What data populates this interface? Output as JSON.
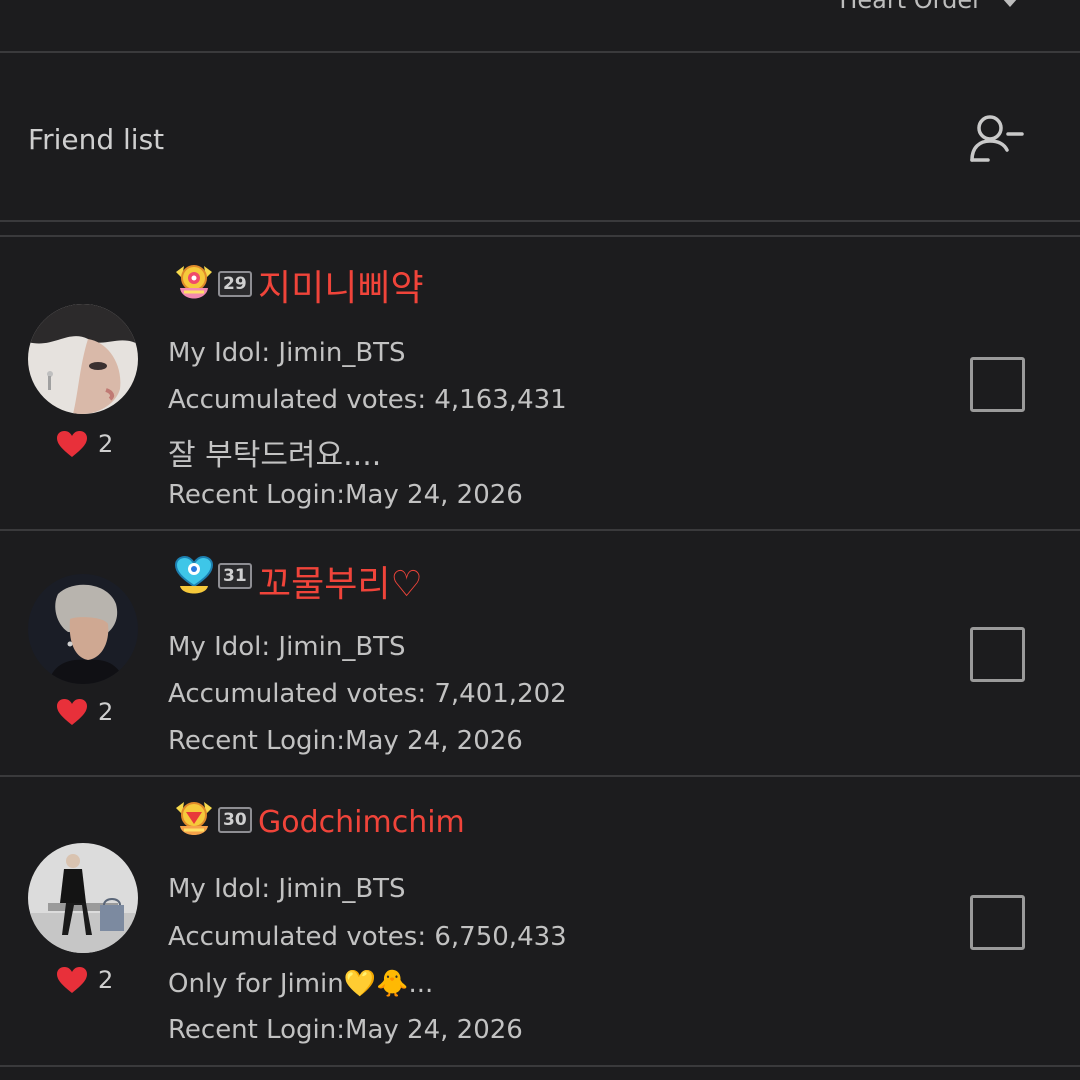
{
  "header": {
    "sort_label": "Heart Order",
    "sort_icon": "chevron-down-icon"
  },
  "friend_bar": {
    "title": "Friend list",
    "action_icon": "remove-friend-icon"
  },
  "colors": {
    "background": "#1c1c1e",
    "accent_nickname": "#f0443a",
    "heart": "#e8303a",
    "divider": "#3a3a3c",
    "text": "#c2c2c2"
  },
  "friends": [
    {
      "hearts": "2",
      "level": "29",
      "nickname": "지미니삐약",
      "idol": "My Idol: Jimin_BTS",
      "votes": "Accumulated votes: 4,163,431",
      "greeting": "잘 부탁드려요....",
      "recent_login": "Recent Login:May 24, 2026"
    },
    {
      "hearts": "2",
      "level": "31",
      "nickname": "꼬물부리♡",
      "idol": "My Idol: Jimin_BTS",
      "votes": "Accumulated votes: 7,401,202",
      "greeting": "",
      "recent_login": "Recent Login:May 24, 2026"
    },
    {
      "hearts": "2",
      "level": "30",
      "nickname": "Godchimchim",
      "idol": "My Idol: Jimin_BTS",
      "votes": "Accumulated votes: 6,750,433",
      "greeting": "Only for Jimin💛🐥...",
      "recent_login": "Recent Login:May 24, 2026"
    }
  ]
}
